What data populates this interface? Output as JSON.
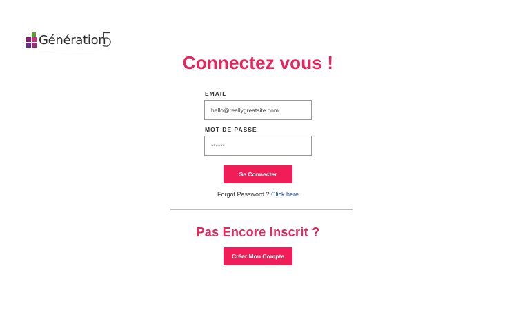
{
  "brand": {
    "logo_text": "Génération",
    "logo_number": "5",
    "colors": {
      "accent": "#e8245a",
      "button": "#f01d58",
      "link": "#1f4fb4"
    }
  },
  "login": {
    "title": "Connectez vous !",
    "email_label": "EMAIL",
    "email_value": "hello@reallygreatsite.com",
    "password_label": "MOT DE PASSE",
    "password_value": "******",
    "submit_label": "Se Connecter",
    "forgot_text": "Forgot Password ?",
    "forgot_link": "Click here"
  },
  "signup": {
    "prompt": "Pas Encore Inscrit ?",
    "button_label": "Créer Mon Compte"
  }
}
